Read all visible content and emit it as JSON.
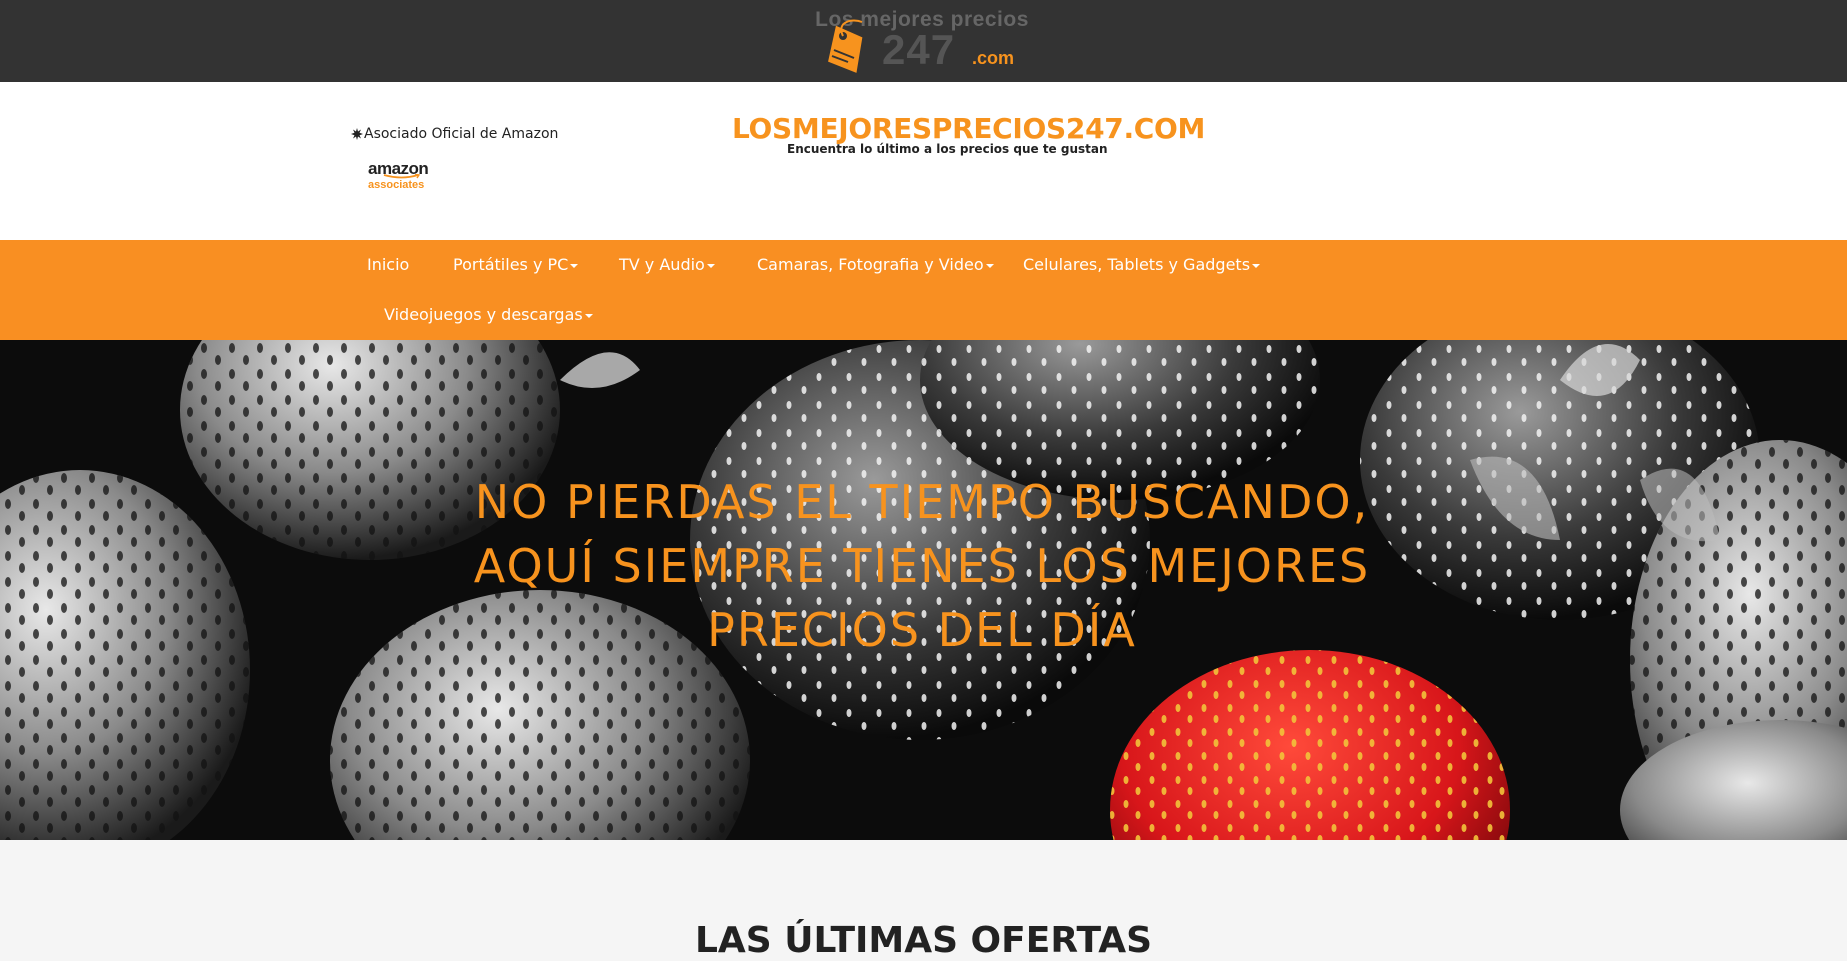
{
  "logo": {
    "line1": "Los mejores precios",
    "number": "247",
    "suffix": ".com",
    "icon": "price-tag-icon"
  },
  "header": {
    "associate_label": "Asociado Oficial de Amazon",
    "associate_icon": "burst-icon",
    "amazon_word": "amazon",
    "amazon_sub": "associates",
    "site_title": "LOSMEJORESPRECIOS247.COM",
    "site_tagline": "Encuentra lo último a los precios que te gustan"
  },
  "nav": {
    "items": [
      {
        "label": "Inicio",
        "dropdown": false
      },
      {
        "label": "Portátiles y PC",
        "dropdown": true
      },
      {
        "label": "TV y Audio",
        "dropdown": true
      },
      {
        "label": "Camaras, Fotografia y Video",
        "dropdown": true
      },
      {
        "label": "Celulares, Tablets y Gadgets",
        "dropdown": true
      },
      {
        "label": "Videojuegos y descargas",
        "dropdown": true
      }
    ]
  },
  "hero": {
    "headline": "No pierdas el tiempo buscando, aquí siempre tienes los mejores precios del día"
  },
  "offers": {
    "title": "LAS ÚLTIMAS OFERTAS"
  },
  "colors": {
    "accent": "#f98f22",
    "topbar": "#333333",
    "hero_text": "#f7931e"
  }
}
